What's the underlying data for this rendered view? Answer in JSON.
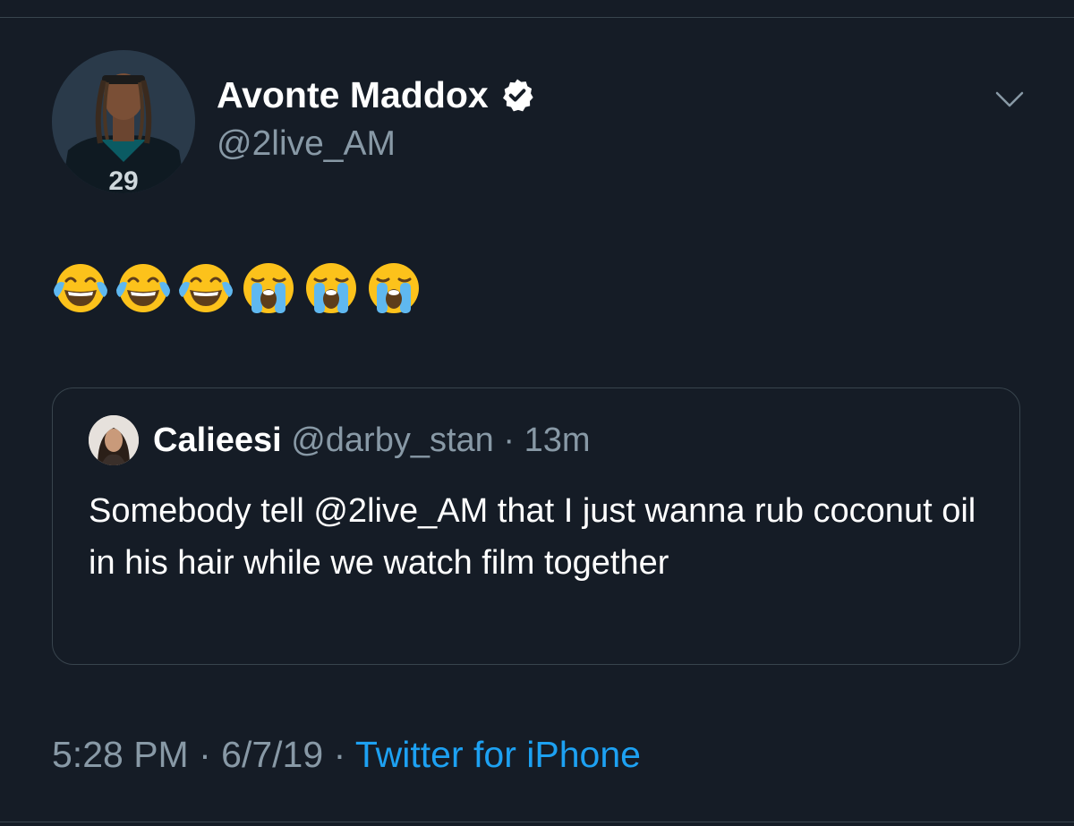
{
  "tweet": {
    "author": {
      "display_name": "Avonte Maddox",
      "handle": "@2live_AM",
      "verified": true
    },
    "text_emojis": [
      "face-with-tears-of-joy",
      "face-with-tears-of-joy",
      "face-with-tears-of-joy",
      "loudly-crying-face",
      "loudly-crying-face",
      "loudly-crying-face"
    ],
    "quoted": {
      "display_name": "Calieesi",
      "handle": "@darby_stan",
      "separator": "·",
      "age": "13m",
      "text": "Somebody tell @2live_AM that I just wanna rub coconut oil in his hair while we watch film together"
    },
    "footer": {
      "time": "5:28 PM",
      "separator1": "·",
      "date": "6/7/19",
      "separator2": "·",
      "source": "Twitter for iPhone"
    }
  },
  "icons": {
    "verified": "verified-badge-icon",
    "menu": "chevron-down-icon"
  },
  "colors": {
    "background": "#151c26",
    "text_primary": "#ffffff",
    "text_secondary": "#8899a6",
    "link": "#1da1f2",
    "border": "#38444d"
  }
}
